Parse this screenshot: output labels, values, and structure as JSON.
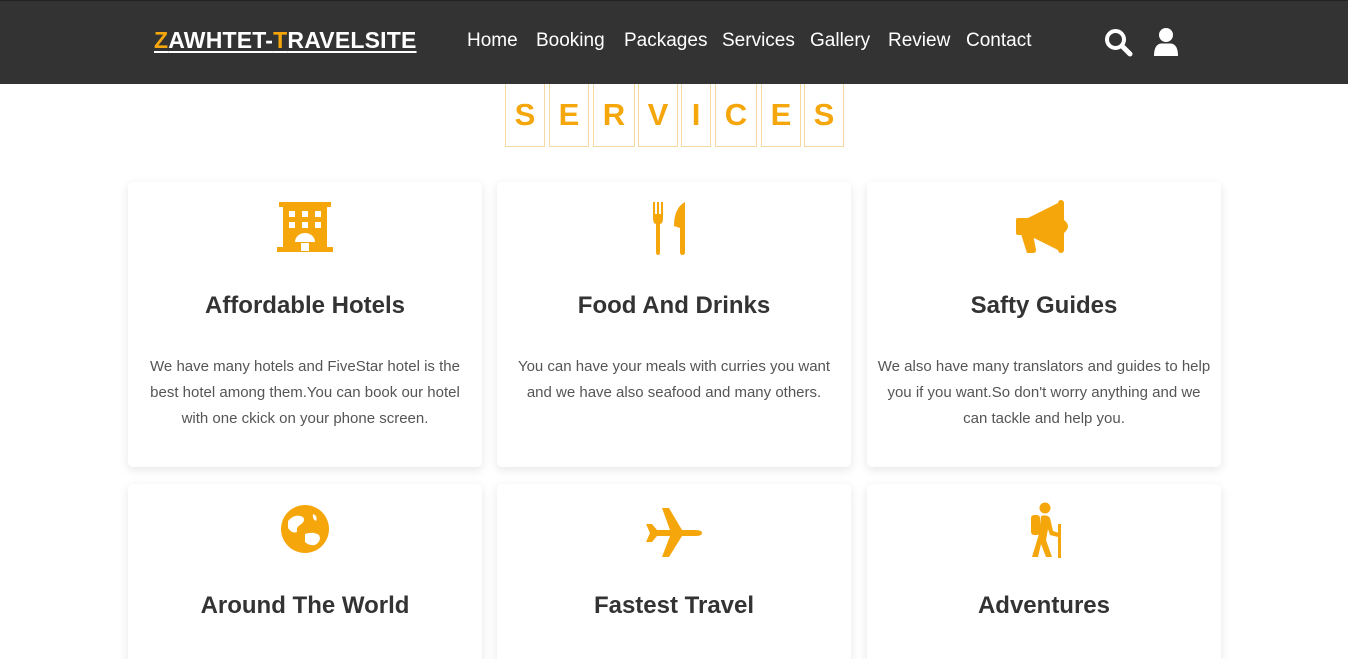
{
  "header": {
    "logo": {
      "first_letter": "Z",
      "part1": "AWHTET-",
      "second_letter": "T",
      "part2": "RAVELSITE"
    },
    "nav": [
      "Home",
      "Booking",
      "Packages",
      "Services",
      "Gallery",
      "Review",
      "Contact"
    ],
    "icons": [
      "search-icon",
      "user-icon"
    ]
  },
  "services": {
    "heading_letters": [
      "S",
      "E",
      "R",
      "V",
      "I",
      "C",
      "E",
      "S"
    ],
    "cards": [
      {
        "icon": "hotel-icon",
        "title": "Affordable Hotels",
        "description": "We have many hotels and FiveStar hotel is the best hotel among them.You can book our hotel with one ckick on your phone screen."
      },
      {
        "icon": "utensils-icon",
        "title": "Food And Drinks",
        "description": "You can have your meals with curries you want and we have also seafood and many others."
      },
      {
        "icon": "bullhorn-icon",
        "title": "Safty Guides",
        "description": "We also have many translators and guides to help you if you want.So don't worry anything and we can tackle and help you."
      },
      {
        "icon": "globe-icon",
        "title": "Around The World",
        "description": ""
      },
      {
        "icon": "plane-icon",
        "title": "Fastest Travel",
        "description": ""
      },
      {
        "icon": "hiking-icon",
        "title": "Adventures",
        "description": ""
      }
    ]
  },
  "colors": {
    "accent": "#f5a60b",
    "header_bg": "#333333",
    "text": "#333333"
  }
}
